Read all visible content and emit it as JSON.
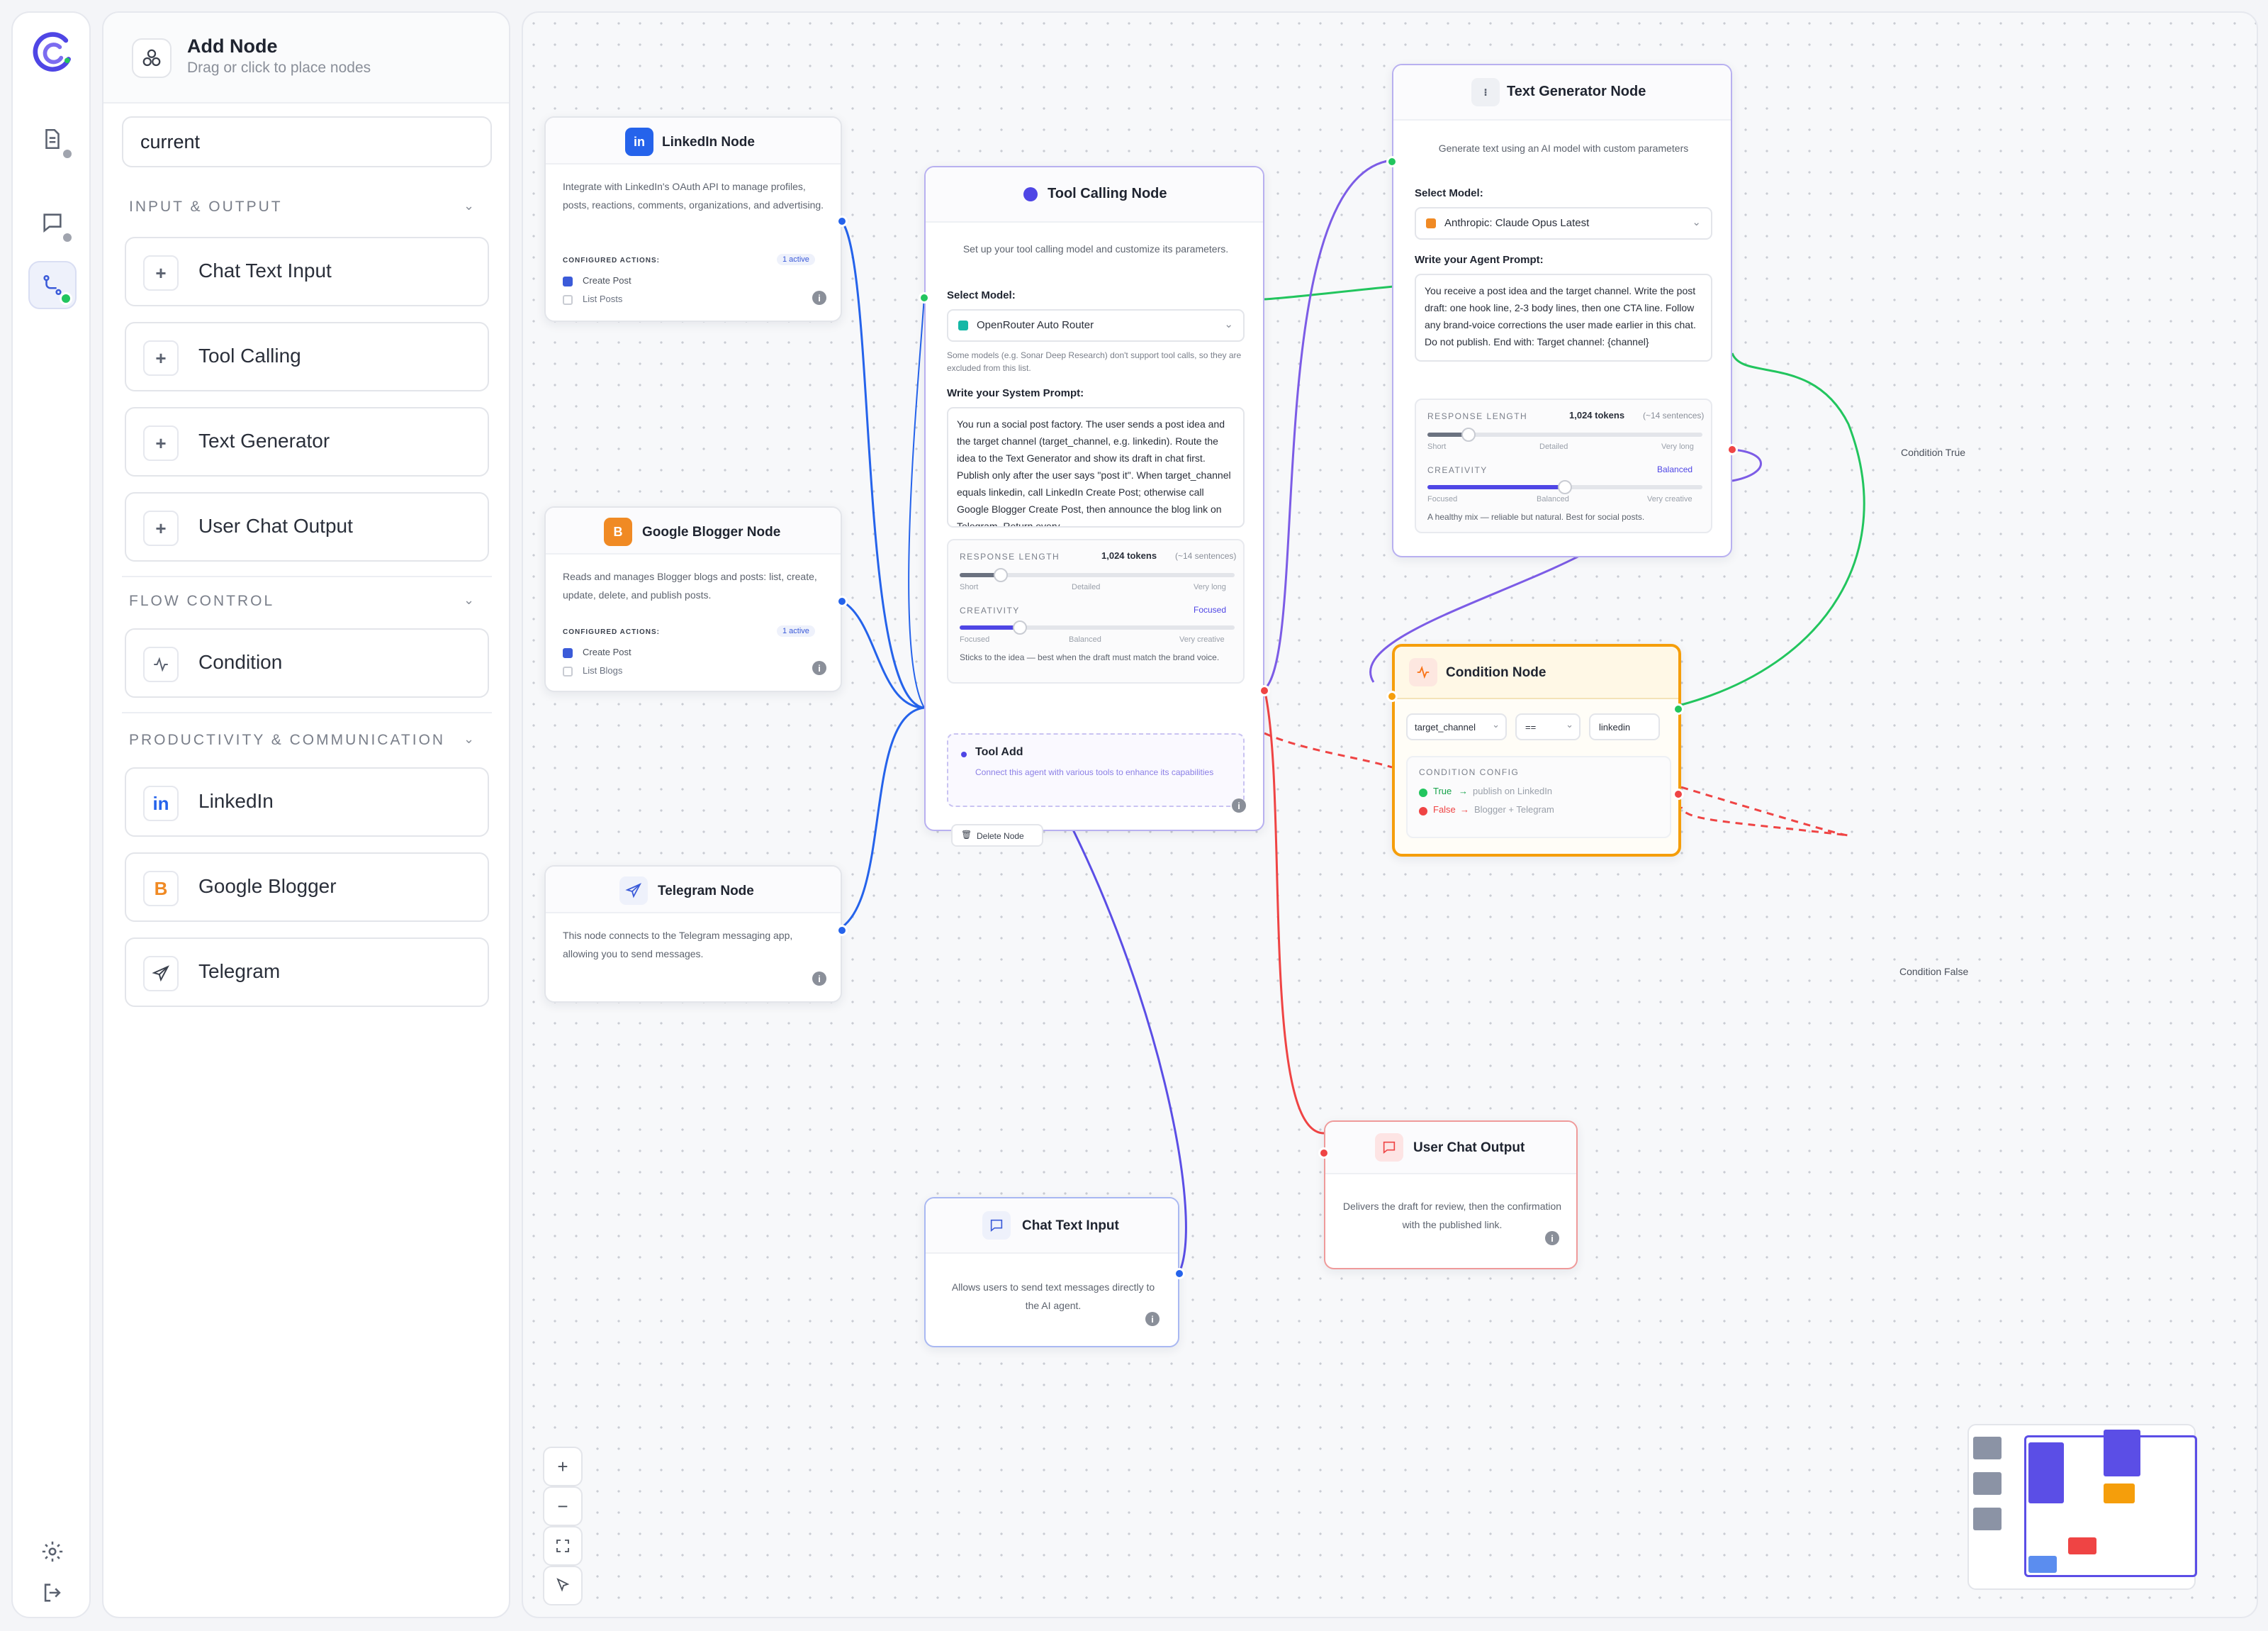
{
  "sidebar_rail": {
    "items": [
      {
        "name": "logo"
      },
      {
        "name": "documents"
      },
      {
        "name": "chat"
      },
      {
        "name": "workflows",
        "active": true
      }
    ]
  },
  "panel": {
    "title": "Add Node",
    "subtitle": "Drag or click to place nodes",
    "search_value": "current",
    "sections": [
      {
        "title": "INPUT & OUTPUT",
        "items": [
          "Chat Text Input",
          "Tool Calling",
          "Text Generator",
          "User Chat Output"
        ]
      },
      {
        "title": "FLOW CONTROL",
        "items": [
          "Condition"
        ]
      },
      {
        "title": "PRODUCTIVITY & COMMUNICATION",
        "items": [
          "LinkedIn",
          "Google Blogger",
          "Telegram"
        ]
      }
    ],
    "prod_badges": {
      "linkedin": "in",
      "blogger": "B"
    }
  },
  "colors": {
    "accent": "#5b4ee6",
    "green": "#22c55e",
    "red": "#ef4444",
    "orange": "#f59e0b",
    "blue": "#2563eb"
  },
  "nodes": {
    "linkedin": {
      "title": "LinkedIn Node",
      "icon": "in",
      "desc": "Integrate with LinkedIn's OAuth API to manage profiles, posts, reactions, comments, organizations, and advertising.",
      "actions_label": "CONFIGURED ACTIONS:",
      "badge": "1 active",
      "actions": [
        {
          "label": "Create Post",
          "checked": true
        },
        {
          "label": "List Posts",
          "checked": false
        }
      ]
    },
    "blogger": {
      "title": "Google Blogger Node",
      "icon": "B",
      "desc": "Reads and manages Blogger blogs and posts: list, create, update, delete, and publish posts.",
      "actions_label": "CONFIGURED ACTIONS:",
      "badge": "1 active",
      "actions": [
        {
          "label": "Create Post",
          "checked": true
        },
        {
          "label": "List Blogs",
          "checked": false
        }
      ]
    },
    "telegram": {
      "title": "Telegram Node",
      "desc": "This node connects to the Telegram messaging app, allowing you to send messages."
    },
    "tool_calling": {
      "title": "Tool Calling Node",
      "desc": "Set up your tool calling model and customize its parameters.",
      "model_label": "Select Model:",
      "model": "OpenRouter Auto Router",
      "model_note": "Some models (e.g. Sonar Deep Research) don't support tool calls, so they are excluded from this list.",
      "prompt_label": "Write your System Prompt:",
      "prompt": "You run a social post factory. The user sends a post idea and the target channel (target_channel, e.g. linkedin). Route the idea to the Text Generator and show its draft in chat first. Publish only after the user says \"post it\". When target_channel equals linkedin, call LinkedIn Create Post; otherwise call Google Blogger Create Post, then announce the blog link on Telegram. Return every",
      "response_length": {
        "label": "RESPONSE LENGTH",
        "value": "1,024 tokens",
        "approx": "(~14 sentences)",
        "level": 0.15,
        "ticks": [
          "Short",
          "Detailed",
          "Very long"
        ]
      },
      "creativity": {
        "label": "CREATIVITY",
        "value": "Focused",
        "level": 0.22,
        "ticks": [
          "Focused",
          "Balanced",
          "Very creative"
        ]
      },
      "creativity_note": "Sticks to the idea — best when the draft must match the brand voice.",
      "tool_add_title": "Tool Add",
      "tool_add_desc": "Connect this agent with various tools to enhance its capabilities",
      "delete_label": "Delete Node"
    },
    "text_generator": {
      "title": "Text Generator Node",
      "desc": "Generate text using an AI model with custom parameters",
      "model_label": "Select Model:",
      "model": "Anthropic: Claude Opus Latest",
      "prompt_label": "Write your Agent Prompt:",
      "prompt": "You receive a post idea and the target channel. Write the post draft: one hook line, 2-3 body lines, then one CTA line. Follow any brand-voice corrections the user made earlier in this chat. Do not publish. End with: Target channel: {channel}",
      "response_length": {
        "label": "RESPONSE LENGTH",
        "value": "1,024 tokens",
        "approx": "(~14 sentences)",
        "level": 0.15,
        "ticks": [
          "Short",
          "Detailed",
          "Very long"
        ]
      },
      "creativity": {
        "label": "CREATIVITY",
        "value": "Balanced",
        "level": 0.5,
        "ticks": [
          "Focused",
          "Balanced",
          "Very creative"
        ]
      },
      "creativity_note": "A healthy mix — reliable but natural. Best for social posts."
    },
    "condition": {
      "title": "Condition Node",
      "field": "target_channel",
      "operator": "==",
      "value": "linkedin",
      "config_label": "CONDITION CONFIG",
      "true_label": "True",
      "true_target": "publish on LinkedIn",
      "false_label": "False",
      "false_target": "Blogger + Telegram"
    },
    "chat_input": {
      "title": "Chat Text Input",
      "desc": "Allows users to send text messages directly to the AI agent."
    },
    "chat_output": {
      "title": "User Chat Output",
      "desc": "Delivers the draft for review, then the confirmation with the published link."
    }
  },
  "edge_labels": {
    "cond_true": "Condition True",
    "cond_false": "Condition False"
  },
  "controls": [
    "zoom-in",
    "zoom-out",
    "fit-view",
    "toggle-interactivity"
  ]
}
